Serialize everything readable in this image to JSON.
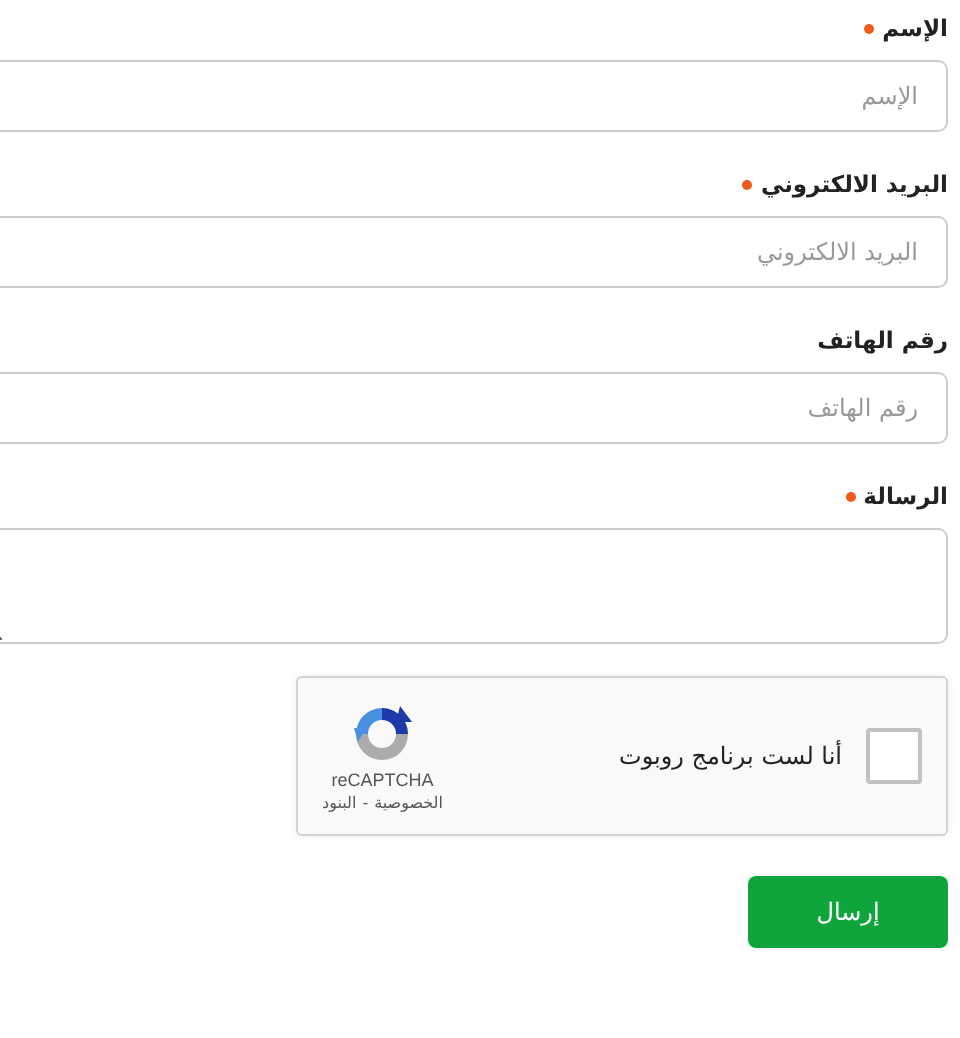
{
  "fields": [
    {
      "kind": "input",
      "label": "الإسم",
      "required": true,
      "placeholder": "الإسم"
    },
    {
      "kind": "input",
      "label": "البريد الالكتروني",
      "required": true,
      "placeholder": "البريد الالكتروني"
    },
    {
      "kind": "input",
      "label": "رقم الهاتف",
      "required": false,
      "placeholder": "رقم الهاتف"
    },
    {
      "kind": "textarea",
      "label": "الرسالة",
      "required": true
    }
  ],
  "recaptcha": {
    "label": "أنا لست برنامج روبوت",
    "checked": false,
    "brand": "reCAPTCHA",
    "links": [
      "الخصوصية",
      "البنود"
    ],
    "separator": "-"
  },
  "submit": "إرسال"
}
